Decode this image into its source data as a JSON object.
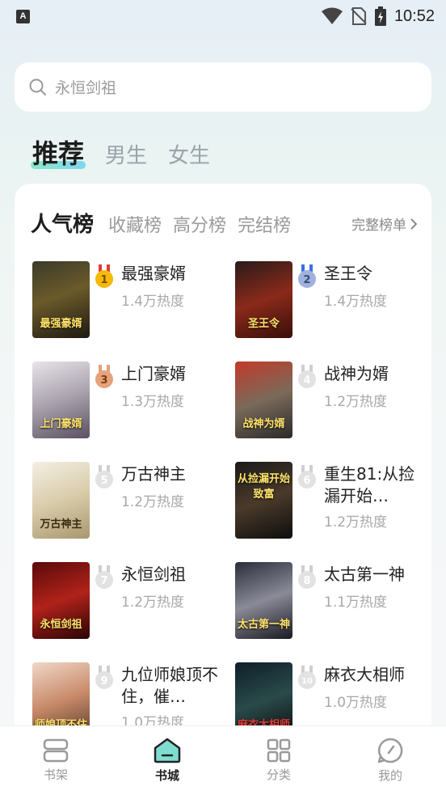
{
  "status": {
    "time": "10:52",
    "app_badge": "A"
  },
  "search": {
    "placeholder": "永恒剑祖"
  },
  "main_tabs": [
    {
      "label": "推荐"
    },
    {
      "label": "男生"
    },
    {
      "label": "女生"
    }
  ],
  "rank_tabs": [
    {
      "label": "人气榜"
    },
    {
      "label": "收藏榜"
    },
    {
      "label": "高分榜"
    },
    {
      "label": "完结榜"
    }
  ],
  "full_list_label": "完整榜单",
  "books": [
    {
      "rank": "1",
      "title": "最强豪婿",
      "heat": "1.4万热度",
      "cover_text": "最强豪婿"
    },
    {
      "rank": "2",
      "title": "圣王令",
      "heat": "1.4万热度",
      "cover_text": "圣王令"
    },
    {
      "rank": "3",
      "title": "上门豪婿",
      "heat": "1.3万热度",
      "cover_text": "上门豪婿"
    },
    {
      "rank": "4",
      "title": "战神为婿",
      "heat": "1.2万热度",
      "cover_text": "战神为婿"
    },
    {
      "rank": "5",
      "title": "万古神主",
      "heat": "1.2万热度",
      "cover_text": "万古神主"
    },
    {
      "rank": "6",
      "title": "重生81:从捡漏开始…",
      "heat": "1.2万热度",
      "cover_text": "从捡漏开始致富"
    },
    {
      "rank": "7",
      "title": "永恒剑祖",
      "heat": "1.2万热度",
      "cover_text": "永恒剑祖"
    },
    {
      "rank": "8",
      "title": "太古第一神",
      "heat": "1.1万热度",
      "cover_text": "太古第一神"
    },
    {
      "rank": "9",
      "title": "九位师娘顶不住，催…",
      "heat": "1.0万热度",
      "cover_text": "师娘顶不住"
    },
    {
      "rank": "10",
      "title": "麻衣大相师",
      "heat": "1.0万热度",
      "cover_text": "麻衣大相师"
    }
  ],
  "bottom_nav": [
    {
      "label": "书架"
    },
    {
      "label": "书城"
    },
    {
      "label": "分类"
    },
    {
      "label": "我的"
    }
  ],
  "colors": {
    "accent": "#7fdcd0",
    "gold": "#f5b90a",
    "silver": "#8fa7d8",
    "bronze": "#e09a6a",
    "gray_medal": "#d8d8d8"
  }
}
